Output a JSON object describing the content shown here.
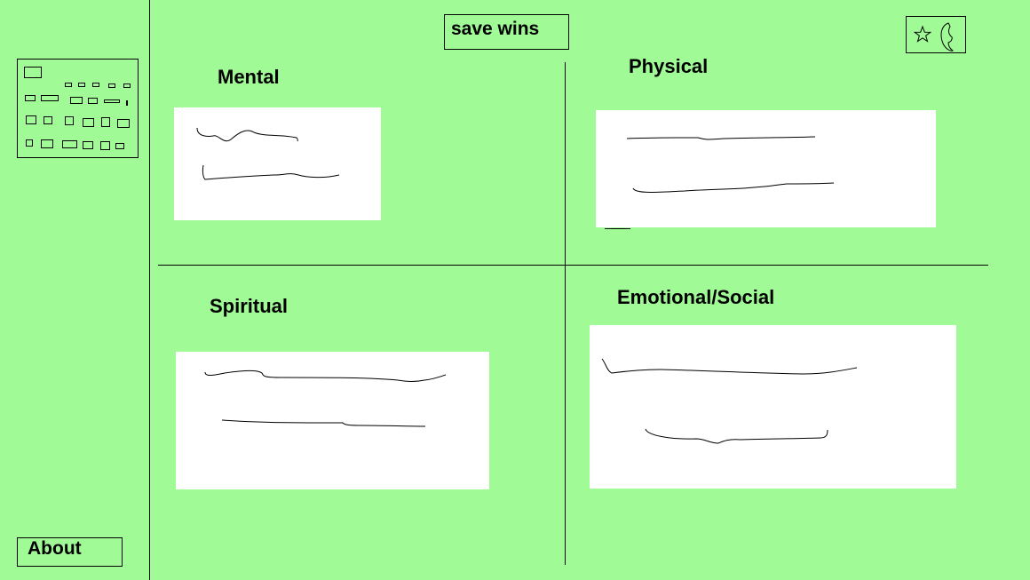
{
  "header": {
    "save_label": "save wins"
  },
  "theme_toggle": {
    "icons": [
      "star-icon",
      "moon-icon"
    ]
  },
  "sidebar": {
    "about_label": "About"
  },
  "sections": {
    "mental": {
      "title": "Mental"
    },
    "physical": {
      "title": "Physical"
    },
    "spiritual": {
      "title": "Spiritual"
    },
    "emotional_social": {
      "title": "Emotional/Social"
    }
  },
  "colors": {
    "background": "#a0fa96",
    "panel": "#ffffff",
    "ink": "#000000"
  }
}
